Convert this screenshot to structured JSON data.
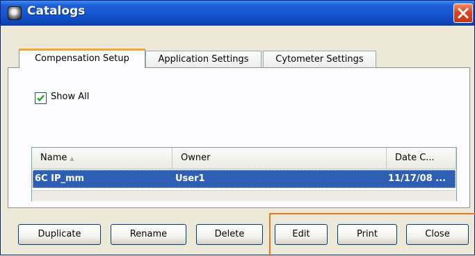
{
  "window": {
    "title": "Catalogs",
    "close_label": "×"
  },
  "tabs": [
    {
      "label": "Compensation Setup",
      "active": true
    },
    {
      "label": "Application Settings",
      "active": false
    },
    {
      "label": "Cytometer Settings",
      "active": false
    }
  ],
  "show_all": {
    "label": "Show All",
    "checked": true
  },
  "table": {
    "columns": [
      "Name",
      "Owner",
      "Date C..."
    ],
    "rows": [
      {
        "name": "6C IP_mm",
        "owner": "User1",
        "date": "11/17/08 ...",
        "selected": true
      }
    ]
  },
  "buttons": {
    "duplicate": "Duplicate",
    "rename": "Rename",
    "delete": "Delete",
    "edit": "Edit",
    "print": "Print",
    "close": "Close"
  },
  "colors": {
    "titlebar": "#1455cf",
    "selection": "#2f5fb3",
    "active_tab_accent": "#f0a830",
    "highlight_box": "#e8791f",
    "close_button": "#d84522"
  },
  "icons": [
    "app-icon",
    "close-icon",
    "checkmark-icon",
    "sort-ascending-icon"
  ]
}
